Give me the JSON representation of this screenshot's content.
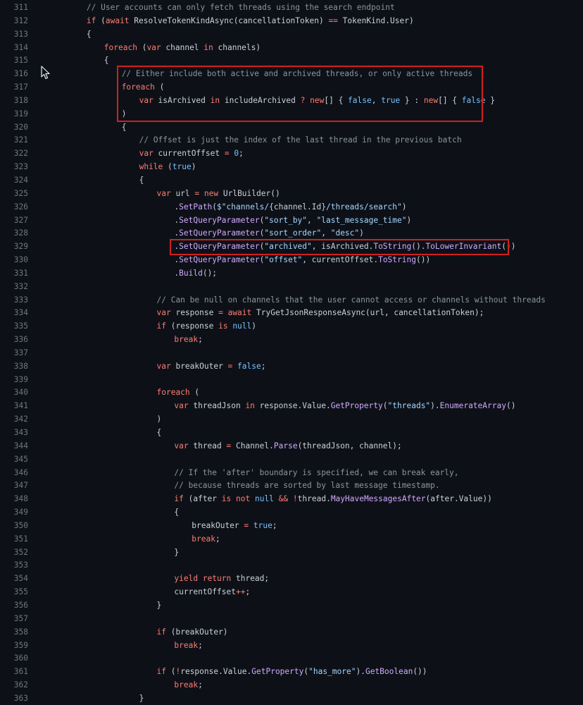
{
  "colors": {
    "background": "#0d1117",
    "text": "#c9d1d9",
    "line_number": "#6e7681",
    "comment": "#8b949e",
    "keyword": "#ff7b72",
    "function": "#d2a8ff",
    "string": "#a5d6ff",
    "constant": "#79c0ff",
    "highlight_border": "#d21f1f"
  },
  "cursor": {
    "icon": "mouse-pointer-icon"
  },
  "code": {
    "lines": [
      {
        "n": "311",
        "indent": 1,
        "t": [
          [
            "c",
            "// User accounts can only fetch threads using the search endpoint"
          ]
        ]
      },
      {
        "n": "312",
        "indent": 1,
        "t": [
          [
            "k",
            "if"
          ],
          [
            "t",
            " ("
          ],
          [
            "k",
            "await"
          ],
          [
            "t",
            " ResolveTokenKindAsync(cancellationToken) "
          ],
          [
            "o",
            "=="
          ],
          [
            "t",
            " TokenKind.User)"
          ]
        ]
      },
      {
        "n": "313",
        "indent": 1,
        "t": [
          [
            "t",
            "{"
          ]
        ]
      },
      {
        "n": "314",
        "indent": 2,
        "t": [
          [
            "k",
            "foreach"
          ],
          [
            "t",
            " ("
          ],
          [
            "k",
            "var"
          ],
          [
            "t",
            " channel "
          ],
          [
            "k",
            "in"
          ],
          [
            "t",
            " channels)"
          ]
        ]
      },
      {
        "n": "315",
        "indent": 2,
        "t": [
          [
            "t",
            "{"
          ]
        ]
      },
      {
        "n": "316",
        "indent": 3,
        "t": [
          [
            "c",
            "// Either include both active and archived threads, or only active threads"
          ]
        ]
      },
      {
        "n": "317",
        "indent": 3,
        "t": [
          [
            "k",
            "foreach"
          ],
          [
            "t",
            " ("
          ]
        ]
      },
      {
        "n": "318",
        "indent": 4,
        "t": [
          [
            "k",
            "var"
          ],
          [
            "t",
            " isArchived "
          ],
          [
            "k",
            "in"
          ],
          [
            "t",
            " includeArchived "
          ],
          [
            "o",
            "?"
          ],
          [
            "t",
            " "
          ],
          [
            "k",
            "new"
          ],
          [
            "t",
            "[] { "
          ],
          [
            "n",
            "false"
          ],
          [
            "t",
            ", "
          ],
          [
            "n",
            "true"
          ],
          [
            "t",
            " } : "
          ],
          [
            "k",
            "new"
          ],
          [
            "t",
            "[] { "
          ],
          [
            "n",
            "false"
          ],
          [
            "t",
            " }"
          ]
        ]
      },
      {
        "n": "319",
        "indent": 3,
        "t": [
          [
            "t",
            ")"
          ]
        ]
      },
      {
        "n": "320",
        "indent": 3,
        "t": [
          [
            "t",
            "{"
          ]
        ]
      },
      {
        "n": "321",
        "indent": 4,
        "t": [
          [
            "c",
            "// Offset is just the index of the last thread in the previous batch"
          ]
        ]
      },
      {
        "n": "322",
        "indent": 4,
        "t": [
          [
            "k",
            "var"
          ],
          [
            "t",
            " currentOffset "
          ],
          [
            "o",
            "="
          ],
          [
            "t",
            " "
          ],
          [
            "n",
            "0"
          ],
          [
            "t",
            ";"
          ]
        ]
      },
      {
        "n": "323",
        "indent": 4,
        "t": [
          [
            "k",
            "while"
          ],
          [
            "t",
            " ("
          ],
          [
            "n",
            "true"
          ],
          [
            "t",
            ")"
          ]
        ]
      },
      {
        "n": "324",
        "indent": 4,
        "t": [
          [
            "t",
            "{"
          ]
        ]
      },
      {
        "n": "325",
        "indent": 5,
        "t": [
          [
            "k",
            "var"
          ],
          [
            "t",
            " url "
          ],
          [
            "o",
            "="
          ],
          [
            "t",
            " "
          ],
          [
            "k",
            "new"
          ],
          [
            "t",
            " UrlBuilder()"
          ]
        ]
      },
      {
        "n": "326",
        "indent": 6,
        "t": [
          [
            "t",
            "."
          ],
          [
            "f",
            "SetPath"
          ],
          [
            "t",
            "("
          ],
          [
            "s",
            "$\"channels/{"
          ],
          [
            "t",
            "channel.Id"
          ],
          [
            "s",
            "}/threads/search\""
          ],
          [
            "t",
            ")"
          ]
        ]
      },
      {
        "n": "327",
        "indent": 6,
        "t": [
          [
            "t",
            "."
          ],
          [
            "f",
            "SetQueryParameter"
          ],
          [
            "t",
            "("
          ],
          [
            "s",
            "\"sort_by\""
          ],
          [
            "t",
            ", "
          ],
          [
            "s",
            "\"last_message_time\""
          ],
          [
            "t",
            ")"
          ]
        ]
      },
      {
        "n": "328",
        "indent": 6,
        "t": [
          [
            "t",
            "."
          ],
          [
            "f",
            "SetQueryParameter"
          ],
          [
            "t",
            "("
          ],
          [
            "s",
            "\"sort_order\""
          ],
          [
            "t",
            ", "
          ],
          [
            "s",
            "\"desc\""
          ],
          [
            "t",
            ")"
          ]
        ]
      },
      {
        "n": "329",
        "indent": 6,
        "t": [
          [
            "t",
            "."
          ],
          [
            "f",
            "SetQueryParameter"
          ],
          [
            "t",
            "("
          ],
          [
            "s",
            "\"archived\""
          ],
          [
            "t",
            ", isArchived."
          ],
          [
            "f",
            "ToString"
          ],
          [
            "t",
            "()."
          ],
          [
            "f",
            "ToLowerInvariant"
          ],
          [
            "t",
            "())"
          ]
        ]
      },
      {
        "n": "330",
        "indent": 6,
        "t": [
          [
            "t",
            "."
          ],
          [
            "f",
            "SetQueryParameter"
          ],
          [
            "t",
            "("
          ],
          [
            "s",
            "\"offset\""
          ],
          [
            "t",
            ", currentOffset."
          ],
          [
            "f",
            "ToString"
          ],
          [
            "t",
            "())"
          ]
        ]
      },
      {
        "n": "331",
        "indent": 6,
        "t": [
          [
            "t",
            "."
          ],
          [
            "f",
            "Build"
          ],
          [
            "t",
            "();"
          ]
        ]
      },
      {
        "n": "332",
        "indent": 0,
        "t": []
      },
      {
        "n": "333",
        "indent": 5,
        "t": [
          [
            "c",
            "// Can be null on channels that the user cannot access or channels without threads"
          ]
        ]
      },
      {
        "n": "334",
        "indent": 5,
        "t": [
          [
            "k",
            "var"
          ],
          [
            "t",
            " response "
          ],
          [
            "o",
            "="
          ],
          [
            "t",
            " "
          ],
          [
            "k",
            "await"
          ],
          [
            "t",
            " TryGetJsonResponseAsync(url, cancellationToken);"
          ]
        ]
      },
      {
        "n": "335",
        "indent": 5,
        "t": [
          [
            "k",
            "if"
          ],
          [
            "t",
            " (response "
          ],
          [
            "k",
            "is"
          ],
          [
            "t",
            " "
          ],
          [
            "n",
            "null"
          ],
          [
            "t",
            ")"
          ]
        ]
      },
      {
        "n": "336",
        "indent": 6,
        "t": [
          [
            "k",
            "break"
          ],
          [
            "t",
            ";"
          ]
        ]
      },
      {
        "n": "337",
        "indent": 0,
        "t": []
      },
      {
        "n": "338",
        "indent": 5,
        "t": [
          [
            "k",
            "var"
          ],
          [
            "t",
            " breakOuter "
          ],
          [
            "o",
            "="
          ],
          [
            "t",
            " "
          ],
          [
            "n",
            "false"
          ],
          [
            "t",
            ";"
          ]
        ]
      },
      {
        "n": "339",
        "indent": 0,
        "t": []
      },
      {
        "n": "340",
        "indent": 5,
        "t": [
          [
            "k",
            "foreach"
          ],
          [
            "t",
            " ("
          ]
        ]
      },
      {
        "n": "341",
        "indent": 6,
        "t": [
          [
            "k",
            "var"
          ],
          [
            "t",
            " threadJson "
          ],
          [
            "k",
            "in"
          ],
          [
            "t",
            " response.Value."
          ],
          [
            "f",
            "GetProperty"
          ],
          [
            "t",
            "("
          ],
          [
            "s",
            "\"threads\""
          ],
          [
            "t",
            ")."
          ],
          [
            "f",
            "EnumerateArray"
          ],
          [
            "t",
            "()"
          ]
        ]
      },
      {
        "n": "342",
        "indent": 5,
        "t": [
          [
            "t",
            ")"
          ]
        ]
      },
      {
        "n": "343",
        "indent": 5,
        "t": [
          [
            "t",
            "{"
          ]
        ]
      },
      {
        "n": "344",
        "indent": 6,
        "t": [
          [
            "k",
            "var"
          ],
          [
            "t",
            " thread "
          ],
          [
            "o",
            "="
          ],
          [
            "t",
            " Channel."
          ],
          [
            "f",
            "Parse"
          ],
          [
            "t",
            "(threadJson, channel);"
          ]
        ]
      },
      {
        "n": "345",
        "indent": 0,
        "t": []
      },
      {
        "n": "346",
        "indent": 6,
        "t": [
          [
            "c",
            "// If the 'after' boundary is specified, we can break early,"
          ]
        ]
      },
      {
        "n": "347",
        "indent": 6,
        "t": [
          [
            "c",
            "// because threads are sorted by last message timestamp."
          ]
        ]
      },
      {
        "n": "348",
        "indent": 6,
        "t": [
          [
            "k",
            "if"
          ],
          [
            "t",
            " (after "
          ],
          [
            "k",
            "is"
          ],
          [
            "t",
            " "
          ],
          [
            "k",
            "not"
          ],
          [
            "t",
            " "
          ],
          [
            "n",
            "null"
          ],
          [
            "t",
            " "
          ],
          [
            "o",
            "&&"
          ],
          [
            "t",
            " "
          ],
          [
            "o",
            "!"
          ],
          [
            "t",
            "thread."
          ],
          [
            "f",
            "MayHaveMessagesAfter"
          ],
          [
            "t",
            "(after.Value))"
          ]
        ]
      },
      {
        "n": "349",
        "indent": 6,
        "t": [
          [
            "t",
            "{"
          ]
        ]
      },
      {
        "n": "350",
        "indent": 7,
        "t": [
          [
            "t",
            "breakOuter "
          ],
          [
            "o",
            "="
          ],
          [
            "t",
            " "
          ],
          [
            "n",
            "true"
          ],
          [
            "t",
            ";"
          ]
        ]
      },
      {
        "n": "351",
        "indent": 7,
        "t": [
          [
            "k",
            "break"
          ],
          [
            "t",
            ";"
          ]
        ]
      },
      {
        "n": "352",
        "indent": 6,
        "t": [
          [
            "t",
            "}"
          ]
        ]
      },
      {
        "n": "353",
        "indent": 0,
        "t": []
      },
      {
        "n": "354",
        "indent": 6,
        "t": [
          [
            "k",
            "yield"
          ],
          [
            "t",
            " "
          ],
          [
            "k",
            "return"
          ],
          [
            "t",
            " thread;"
          ]
        ]
      },
      {
        "n": "355",
        "indent": 6,
        "t": [
          [
            "t",
            "currentOffset"
          ],
          [
            "o",
            "++"
          ],
          [
            "t",
            ";"
          ]
        ]
      },
      {
        "n": "356",
        "indent": 5,
        "t": [
          [
            "t",
            "}"
          ]
        ]
      },
      {
        "n": "357",
        "indent": 0,
        "t": []
      },
      {
        "n": "358",
        "indent": 5,
        "t": [
          [
            "k",
            "if"
          ],
          [
            "t",
            " (breakOuter)"
          ]
        ]
      },
      {
        "n": "359",
        "indent": 6,
        "t": [
          [
            "k",
            "break"
          ],
          [
            "t",
            ";"
          ]
        ]
      },
      {
        "n": "360",
        "indent": 0,
        "t": []
      },
      {
        "n": "361",
        "indent": 5,
        "t": [
          [
            "k",
            "if"
          ],
          [
            "t",
            " ("
          ],
          [
            "o",
            "!"
          ],
          [
            "t",
            "response.Value."
          ],
          [
            "f",
            "GetProperty"
          ],
          [
            "t",
            "("
          ],
          [
            "s",
            "\"has_more\""
          ],
          [
            "t",
            ")."
          ],
          [
            "f",
            "GetBoolean"
          ],
          [
            "t",
            "())"
          ]
        ]
      },
      {
        "n": "362",
        "indent": 6,
        "t": [
          [
            "k",
            "break"
          ],
          [
            "t",
            ";"
          ]
        ]
      },
      {
        "n": "363",
        "indent": 4,
        "t": [
          [
            "t",
            "}"
          ]
        ]
      }
    ]
  }
}
